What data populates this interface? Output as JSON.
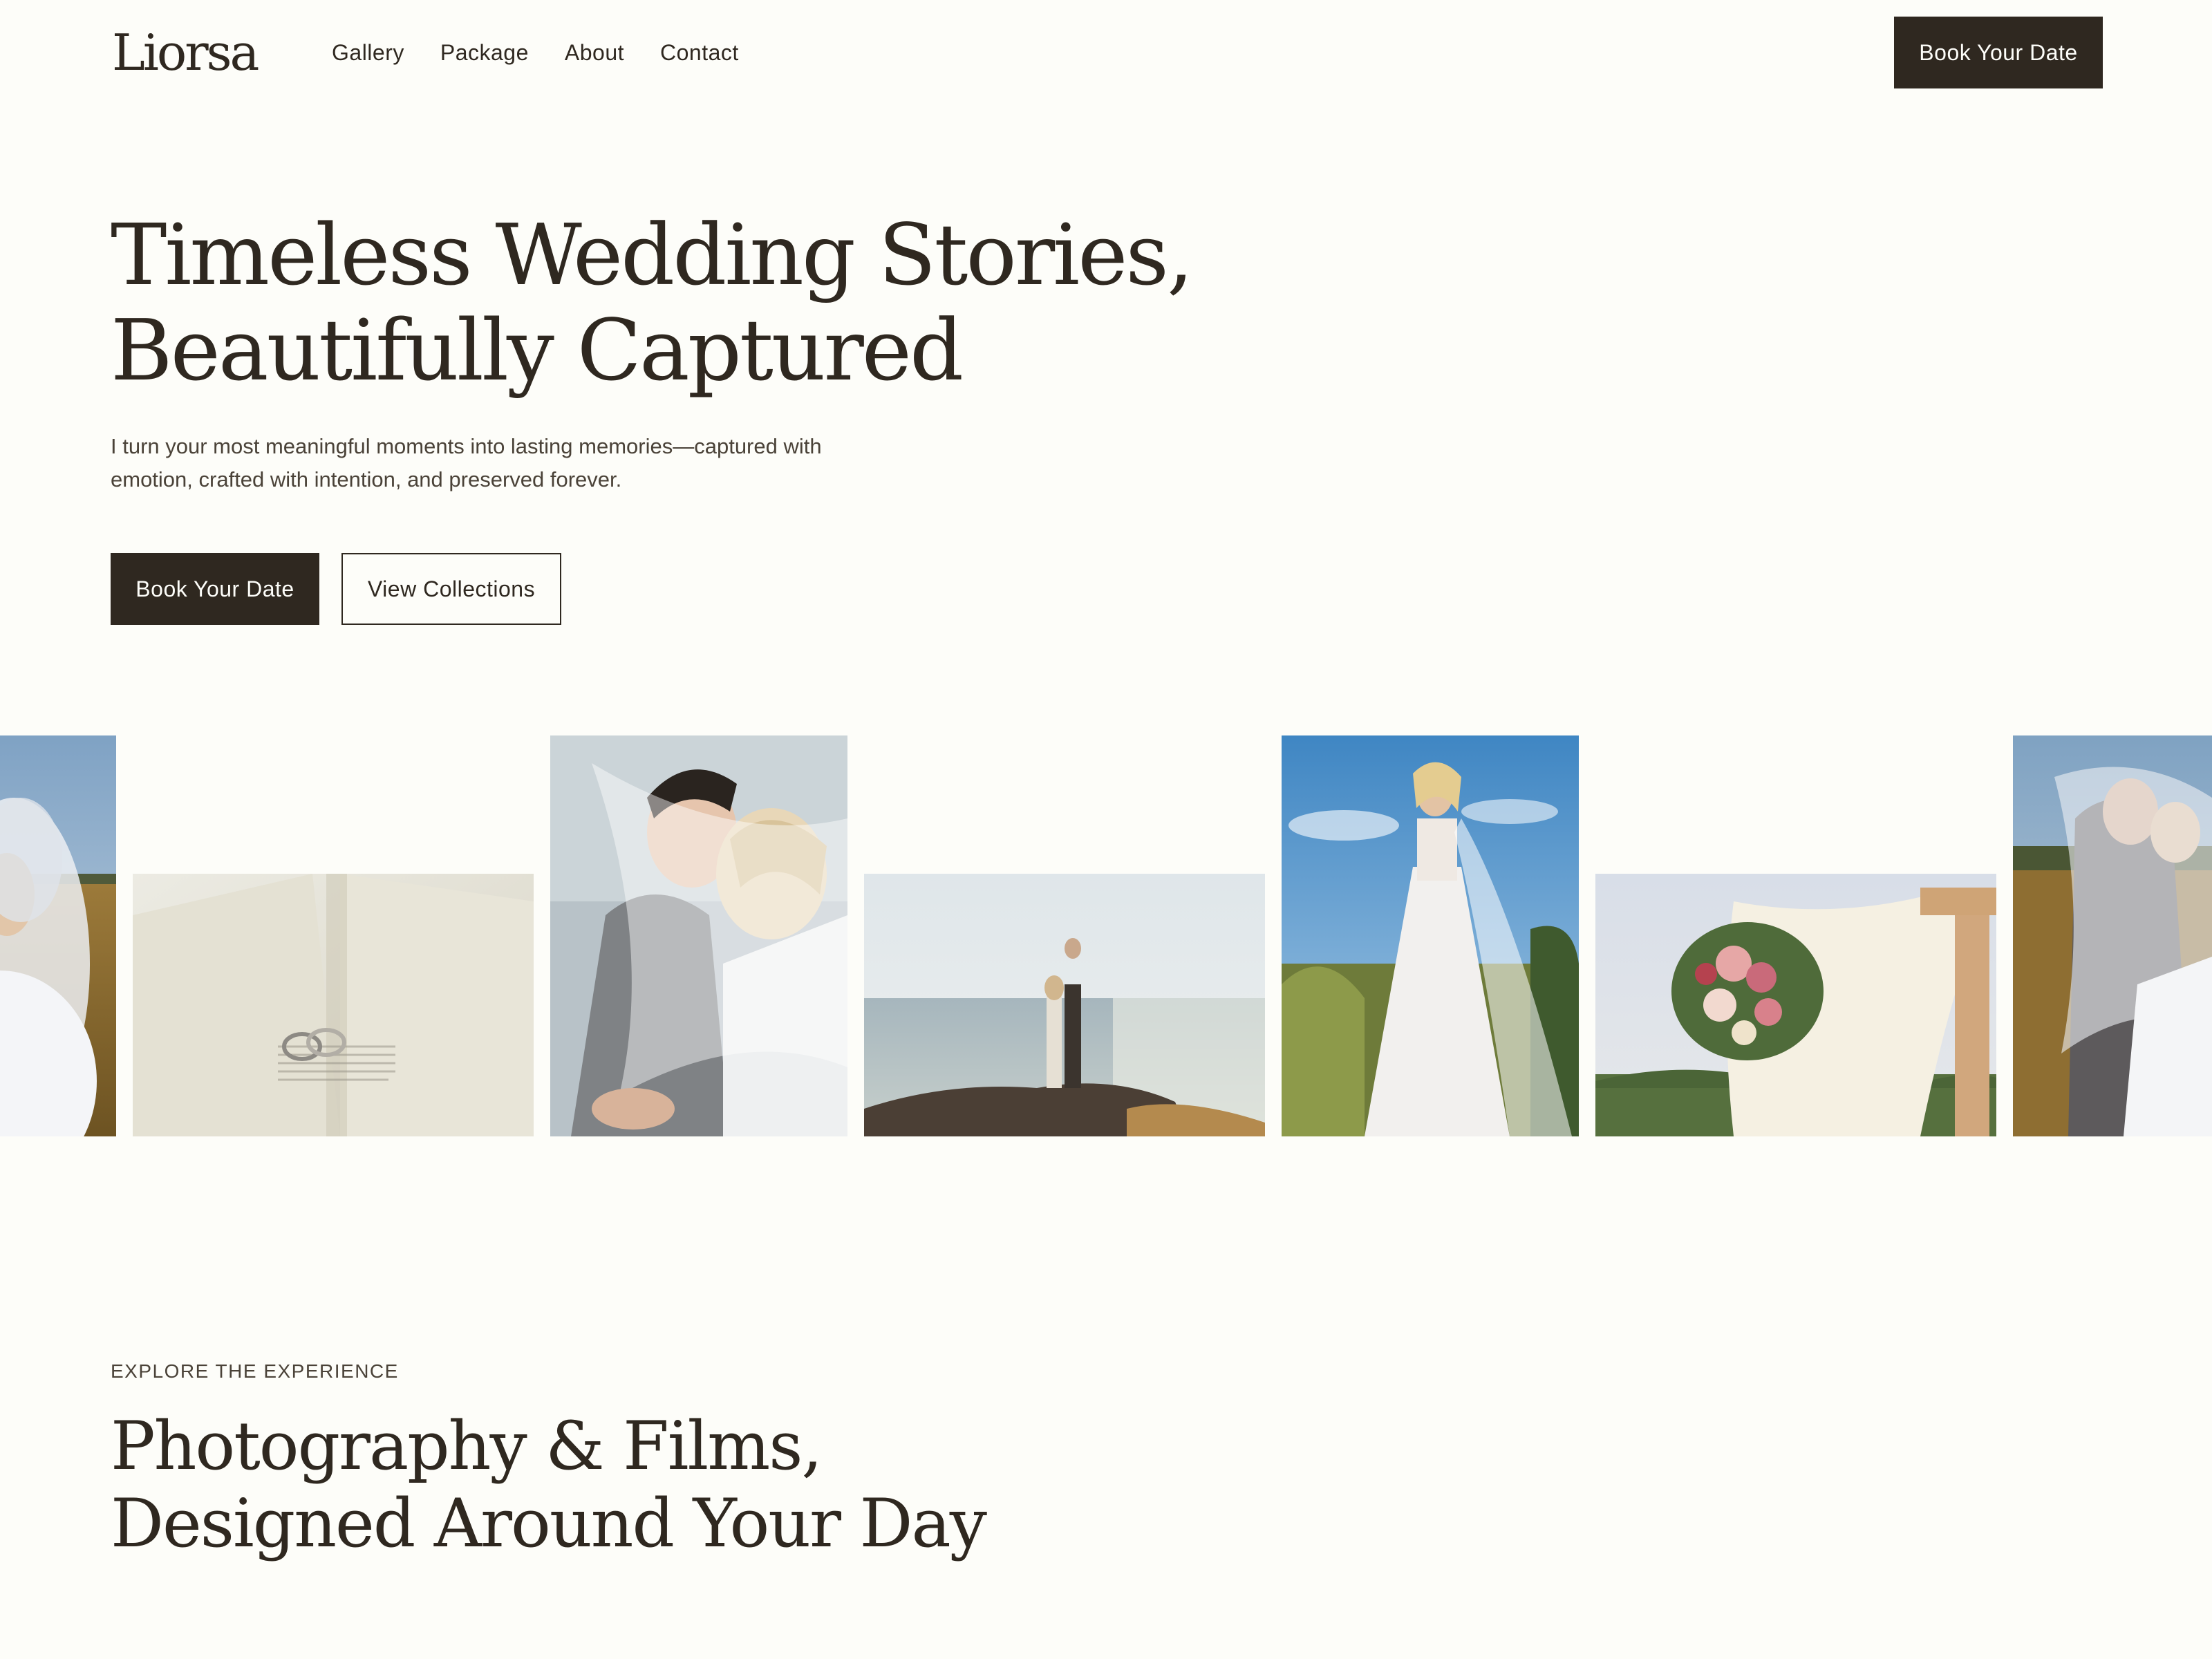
{
  "header": {
    "logo": "Liorsa",
    "nav": [
      "Gallery",
      "Package",
      "About",
      "Contact"
    ],
    "cta_label": "Book Your Date"
  },
  "hero": {
    "title_line1": "Timeless Wedding Stories,",
    "title_line2": "Beautifully Captured",
    "subtitle": "I turn your most meaningful moments into lasting memories—captured with emotion, crafted with intention, and preserved forever.",
    "primary_label": "Book Your Date",
    "secondary_label": "View Collections"
  },
  "gallery": {
    "images": [
      "bride-with-veil-in-field-photo",
      "wedding-rings-on-book-photo",
      "couple-kissing-under-veil-photo",
      "couple-on-coastal-rock-photo",
      "bride-in-lace-gown-photo",
      "floral-arch-bouquet-photo",
      "couple-embracing-in-field-photo"
    ]
  },
  "experience": {
    "eyebrow": "EXPLORE THE EXPERIENCE",
    "title_line1": "Photography & Films,",
    "title_line2": "Designed Around Your Day"
  },
  "colors": {
    "background": "#fdfdf9",
    "ink": "#2f2820",
    "muted": "#4a4238"
  }
}
